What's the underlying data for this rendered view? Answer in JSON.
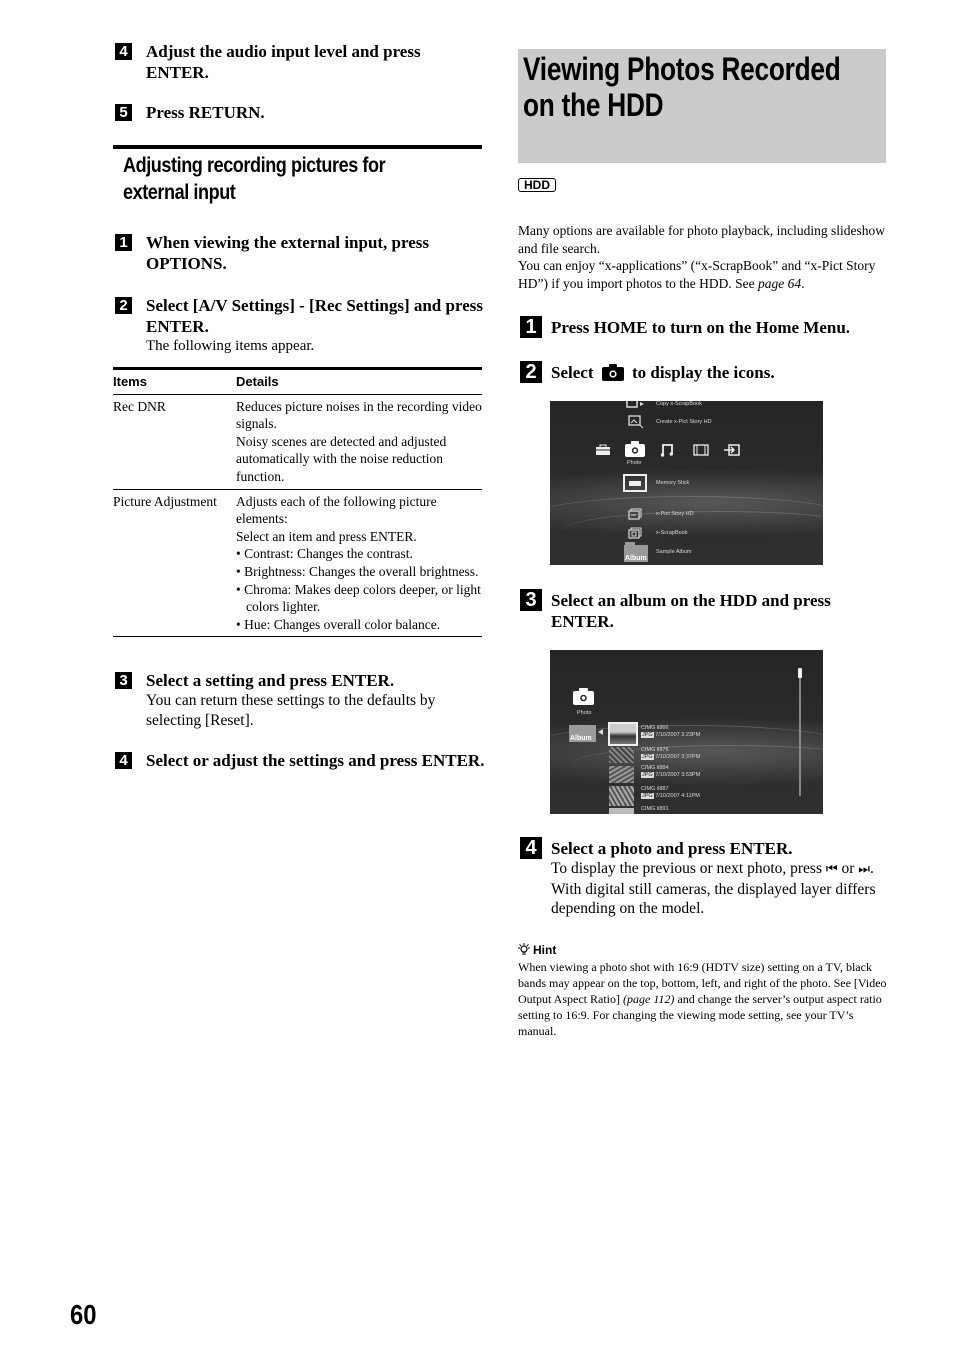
{
  "page_number": "60",
  "left_column": {
    "steps_top": [
      {
        "num": "4",
        "title": "Adjust the audio input level and press ENTER."
      },
      {
        "num": "5",
        "title": "Press RETURN."
      }
    ],
    "section_title": "Adjusting recording pictures for external input",
    "steps": [
      {
        "num": "1",
        "title": "When viewing the external input, press OPTIONS."
      },
      {
        "num": "2",
        "title": "Select [A/V Settings] - [Rec Settings] and press ENTER.",
        "desc": "The following items appear."
      },
      {
        "num": "3",
        "title": "Select a setting and press ENTER.",
        "desc": "You can return these settings to the defaults by selecting [Reset]."
      },
      {
        "num": "4",
        "title": "Select or adjust the settings and press ENTER."
      }
    ],
    "table": {
      "headers": [
        "Items",
        "Details"
      ],
      "rows": [
        {
          "item": "Rec DNR",
          "details": [
            "Reduces picture noises in the recording video signals.",
            "Noisy scenes are detected and adjusted automatically with the noise reduction function."
          ],
          "bullets": []
        },
        {
          "item": "Picture Adjustment",
          "details": [
            "Adjusts each of the following picture elements:",
            "Select an item and press ENTER."
          ],
          "bullets": [
            "• Contrast: Changes the contrast.",
            "• Brightness: Changes the overall brightness.",
            "• Chroma: Makes deep colors deeper, or light colors lighter.",
            "• Hue: Changes overall color balance."
          ]
        }
      ]
    }
  },
  "right_column": {
    "title": "Viewing Photos Recorded on the HDD",
    "badge": "HDD",
    "intro": {
      "p1": "Many options are available for photo playback, including slideshow and file search.",
      "p2_before": "You can enjoy “x-applications” (“x-ScrapBook” and “x-Pict Story HD”) if you import photos to the HDD. See ",
      "p2_link": "page 64",
      "p2_after": "."
    },
    "steps": [
      {
        "num": "1",
        "title": "Press HOME to turn on the Home Menu."
      },
      {
        "num": "2",
        "title_before": "Select",
        "title_icon": "camera-icon",
        "title_after": "to display the icons."
      },
      {
        "num": "3",
        "title": "Select an album on the HDD and press ENTER."
      },
      {
        "num": "4",
        "title": "Select a photo and press ENTER.",
        "desc1_before": "To display the previous or next photo, press",
        "prev_symbol": "⏮",
        "desc1_mid": "or",
        "next_symbol": "⏭",
        "desc2": "With digital still cameras, the displayed layer differs depending on the model."
      }
    ],
    "screen1": {
      "menu_above": [
        "Copy x-ScrapBook",
        "Create x-Pict Story HD"
      ],
      "category_icons": [
        "toolbox-icon",
        "camera-icon",
        "music-note-icon",
        "film-icon",
        "input-icon"
      ],
      "selected_category": "Photo",
      "menu_below": [
        "Memory Stick",
        "x-Pict Story HD",
        "x-ScrapBook",
        "Sample Album"
      ],
      "album_thumb_label": "Album"
    },
    "screen2": {
      "category": "Photo",
      "album_thumb_label": "Album",
      "photos": [
        {
          "name": "CIMG  il866",
          "type": "JPG",
          "date": "7/10/2007  3:23PM"
        },
        {
          "name": "CIMG  il876",
          "type": "JPG",
          "date": "7/10/2007  3:37PM"
        },
        {
          "name": "CIMG  il884",
          "type": "JPG",
          "date": "7/10/2007  3:53PM"
        },
        {
          "name": "CIMG  il887",
          "type": "JPG",
          "date": "7/10/2007  4:11PM"
        },
        {
          "name": "CIMG  il891",
          "type": "",
          "date": ""
        }
      ]
    },
    "hint": {
      "heading": "Hint",
      "body_before": "When viewing a photo shot with 16:9 (HDTV size) setting on a TV, black bands may appear on the top, bottom, left, and right of the photo. See [Video Output Aspect Ratio] ",
      "body_link": "(page 112)",
      "body_after": " and change the server’s output aspect ratio setting to 16:9. For changing the viewing mode setting, see your TV’s manual."
    }
  }
}
